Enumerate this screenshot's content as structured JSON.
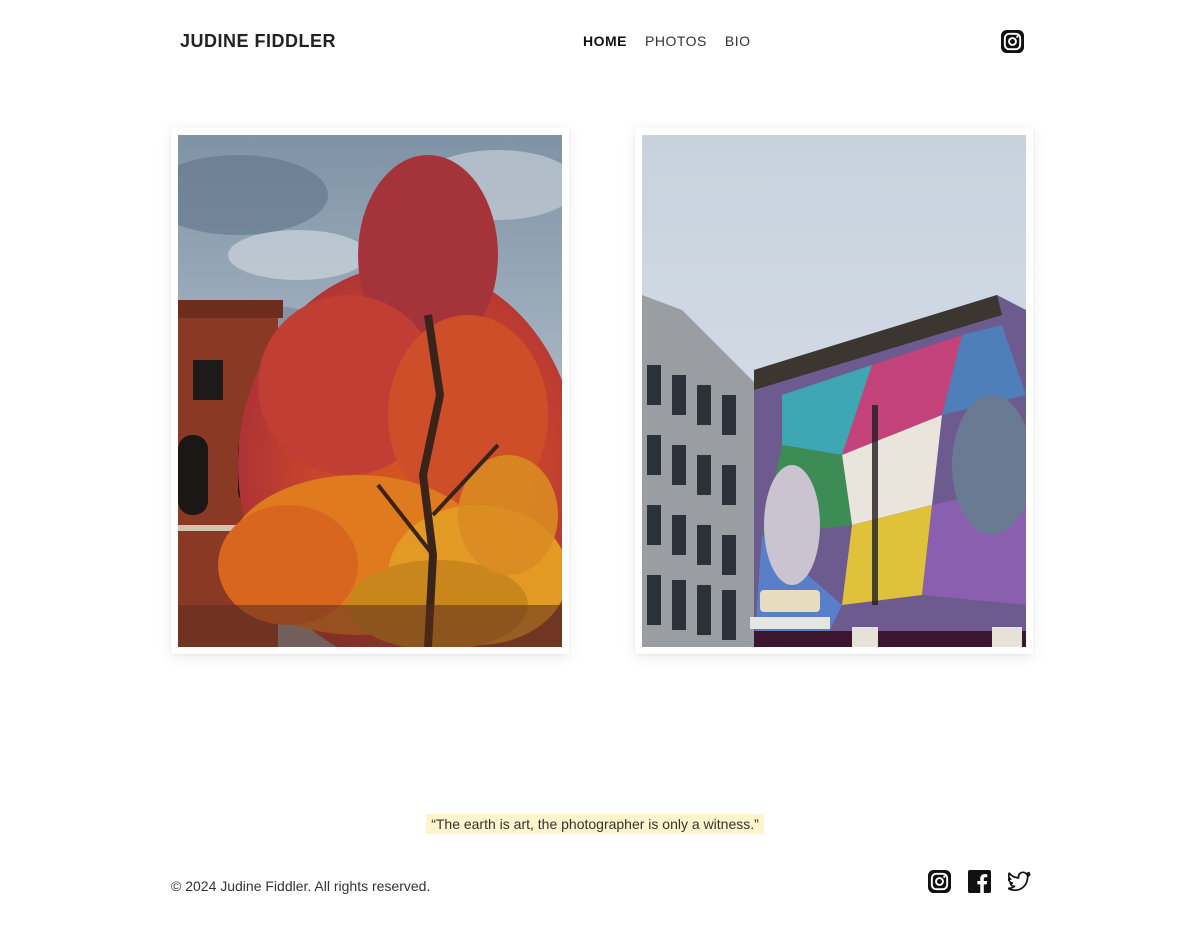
{
  "brand": "JUDINE FIDDLER",
  "nav": [
    {
      "label": "HOME",
      "active": true
    },
    {
      "label": "PHOTOS",
      "active": false
    },
    {
      "label": "BIO",
      "active": false
    }
  ],
  "header_icon": "instagram-icon",
  "photos": [
    {
      "subject": "autumn tree in front of brick building"
    },
    {
      "subject": "colorful mural on building above market"
    }
  ],
  "quote": "“The earth is art, the photographer is only a witness.”",
  "footer": {
    "copyright": "© 2024 Judine Fiddler. All rights reserved.",
    "social_icons": [
      "instagram-icon",
      "facebook-icon",
      "twitter-icon"
    ]
  },
  "colors": {
    "quote_highlight": "#fff4cc",
    "text": "#222222"
  }
}
